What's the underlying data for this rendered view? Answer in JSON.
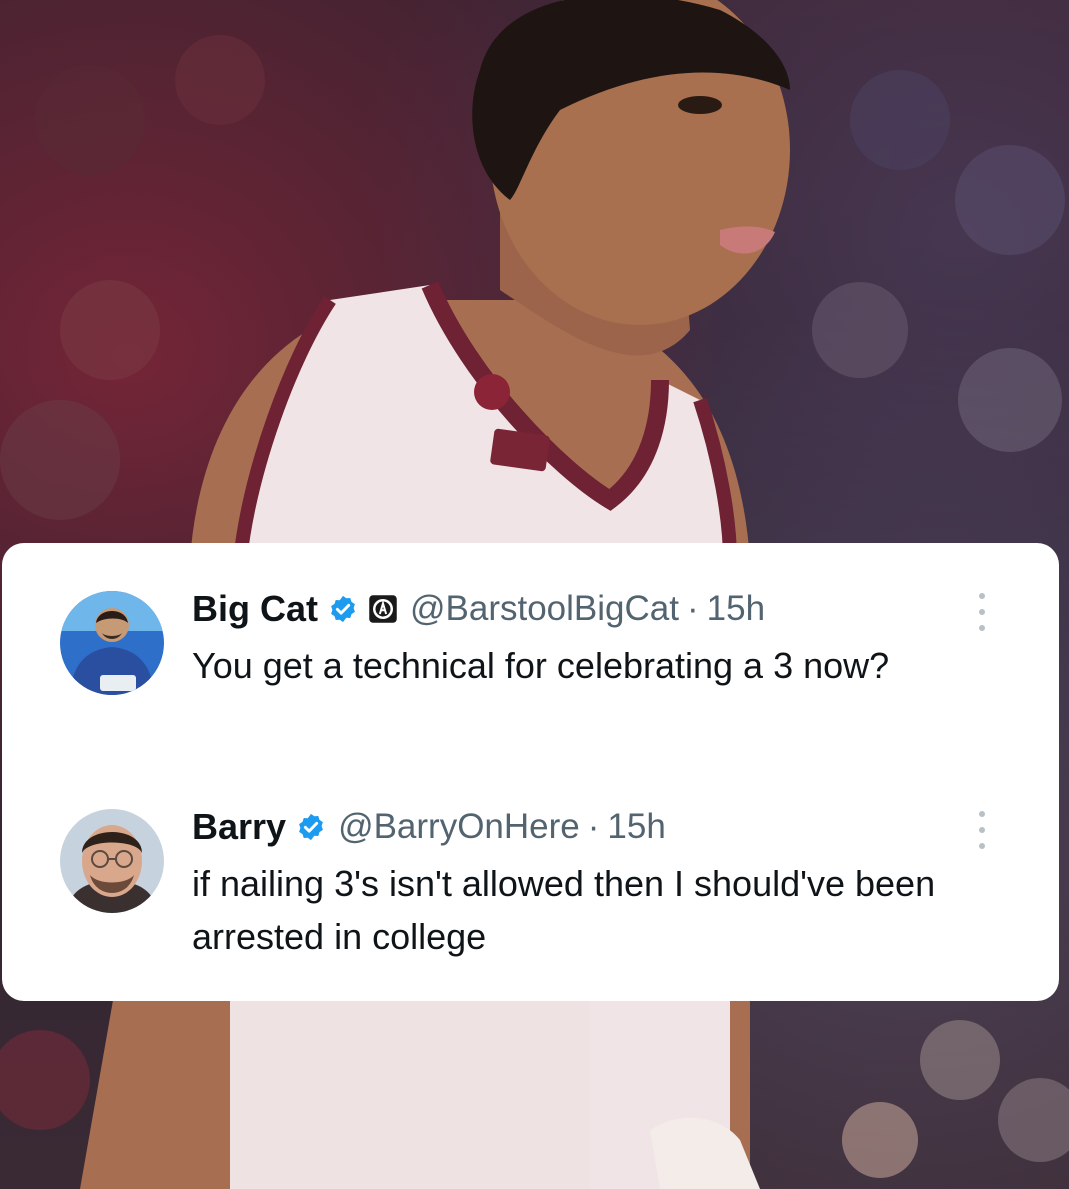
{
  "tweets": [
    {
      "name": "Big Cat",
      "handle": "@BarstoolBigCat",
      "separator": "·",
      "time": "15h",
      "text": "You get a technical for celebrating a 3 now?",
      "verified": true,
      "affiliate_badge": true,
      "avatar_icon": "avatar-big-cat"
    },
    {
      "name": "Barry",
      "handle": "@BarryOnHere",
      "separator": "·",
      "time": "15h",
      "text": "if nailing 3's isn't allowed then I should've been arrested in college",
      "verified": true,
      "affiliate_badge": false,
      "avatar_icon": "avatar-barry"
    }
  ],
  "colors": {
    "verified": "#1d9bf0",
    "text": "#0f1419",
    "secondary": "#536471",
    "jersey": "#f1e4e6",
    "jersey_trim": "#6e2233"
  }
}
